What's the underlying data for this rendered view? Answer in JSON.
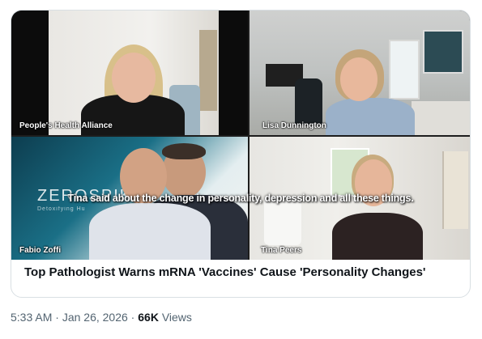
{
  "video": {
    "participants": [
      {
        "name": "People's Health Alliance"
      },
      {
        "name": "Lisa Dunnington"
      },
      {
        "name": "Fabio Zoffi"
      },
      {
        "name": "Tina Peers"
      }
    ],
    "logo_text": "ZEROSPIKE",
    "logo_sub": "Detoxifying Hu",
    "caption": "Tina said about the change in personality, depression and all these things."
  },
  "headline": "Top Pathologist Warns mRNA 'Vaccines' Cause 'Personality Changes'",
  "meta": {
    "time": "5:33 AM",
    "sep1": " · ",
    "date": "Jan 26, 2026",
    "sep2": " · ",
    "views_count": "66K",
    "views_label": " Views"
  }
}
